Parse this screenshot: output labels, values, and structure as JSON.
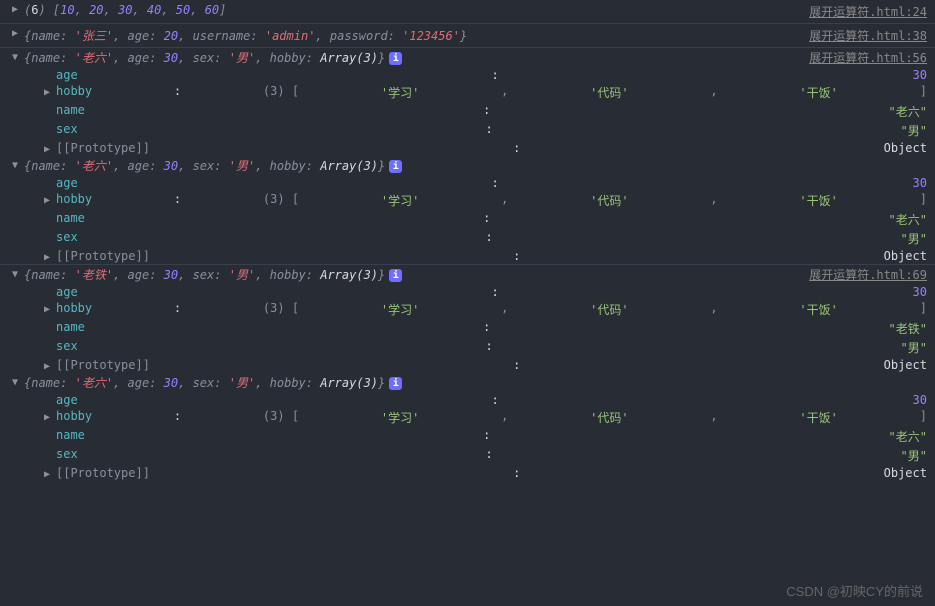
{
  "source_file": "展开运算符.html",
  "lines": {
    "l1": 24,
    "l2": 38,
    "l3": 56,
    "l4": 69
  },
  "array1": {
    "count": 6,
    "items": [
      10,
      20,
      30,
      40,
      50,
      60
    ]
  },
  "obj2": {
    "name": "张三",
    "age": 20,
    "username": "admin",
    "password": "123456"
  },
  "names": {
    "laoliu": "老六",
    "laotie": "老铁"
  },
  "common": {
    "age": 30,
    "sex": "男",
    "hobby_label": "Array(3)",
    "hobby_count": 3,
    "hobby_items": [
      "学习",
      "代码",
      "干饭"
    ],
    "proto_label": "[[Prototype]]",
    "proto_val": "Object"
  },
  "keys": {
    "name": "name",
    "age": "age",
    "sex": "sex",
    "hobby": "hobby",
    "username": "username",
    "password": "password"
  },
  "watermark": "CSDN @初映CY的前说"
}
